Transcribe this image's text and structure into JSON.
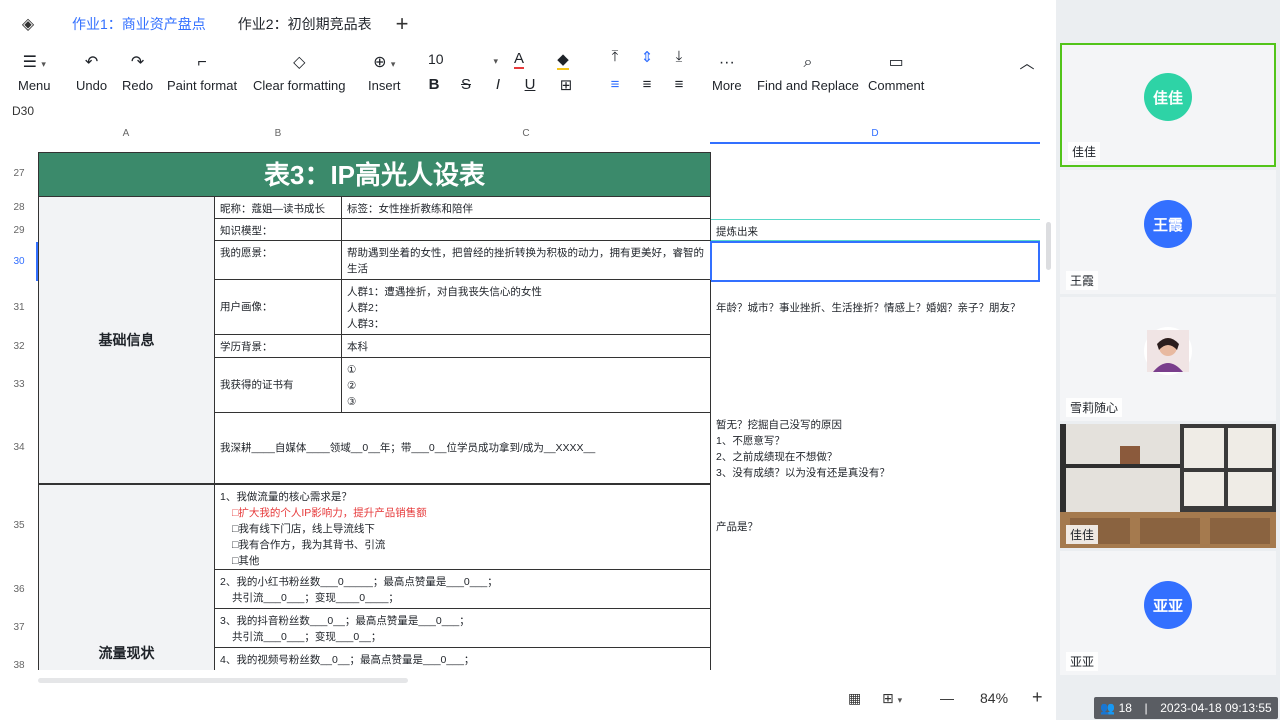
{
  "tabs": [
    {
      "label": "作业1：商业资产盘点",
      "active": true
    },
    {
      "label": "作业2：初创期竞品表",
      "active": false
    }
  ],
  "toolbar": {
    "menu": "Menu",
    "undo": "Undo",
    "redo": "Redo",
    "paint_format": "Paint format",
    "clear_formatting": "Clear formatting",
    "insert": "Insert",
    "font_size": "10",
    "more": "More",
    "find_replace": "Find and Replace",
    "comment": "Comment"
  },
  "cell_ref": "D30",
  "columns": [
    "A",
    "B",
    "C",
    "D"
  ],
  "rows": [
    "27",
    "28",
    "29",
    "30",
    "31",
    "32",
    "33",
    "34",
    "35",
    "36",
    "37",
    "38"
  ],
  "sheet": {
    "title": "表3：IP高光人设表",
    "section_basic": "基础信息",
    "section_traffic": "流量现状",
    "nickname": "昵称：蔻姐—读书成长",
    "tag": "标签：女性挫折教练和陪伴",
    "knowledge_model": "知识模型：",
    "refine_note": "提炼出来",
    "wish_label": "我的愿景：",
    "wish_value": "帮助遇到坐着的女性，把曾经的挫折转换为积极的动力，拥有更美好，睿智的生活",
    "persona_label": "用户画像：",
    "persona_1": "人群1：遭遇挫折，对自我丧失信心的女性",
    "persona_2": "人群2：",
    "persona_3": "人群3：",
    "persona_note": "年龄？城市？事业挫折、生活挫折？情感上？婚姻？亲子？朋友？",
    "edu_label": "学历背景：",
    "edu_value": "本科",
    "cert_label": "我获得的证书有",
    "cert_1": "①",
    "cert_2": "②",
    "cert_3": "③",
    "deep_text": "我深耕____自媒体____领域__0__年；带___0__位学员成功拿到/成为__XXXX__",
    "deep_note_1": "暂无？挖掘自己没写的原因",
    "deep_note_2": "1、不愿意写？",
    "deep_note_3": "2、之前成绩现在不想做？",
    "deep_note_4": "3、没有成绩？以为没有还是真没有？",
    "q1": "1、我做流量的核心需求是？",
    "q1_opt1": "□扩大我的个人IP影响力，提升产品销售额",
    "q1_opt2": "□我有线下门店，线上导流线下",
    "q1_opt3": "□我有合作方，我为其背书、引流",
    "q1_opt4": "□其他",
    "product_note": "产品是？",
    "q2a": "2、我的小红书粉丝数___0_____；最高点赞量是___0___；",
    "q2b": "共引流___0___；变现____0____；",
    "q3a": "3、我的抖音粉丝数___0__；最高点赞量是___0___；",
    "q3b": "共引流___0___；变现___0__；",
    "q4a": "4、我的视频号粉丝数__0__；最高点赞量是___0___；"
  },
  "zoom": "84%",
  "participants": [
    {
      "name": "佳佳",
      "initials": "佳佳",
      "color": "#2ed3a6",
      "speaking": true
    },
    {
      "name": "王霞",
      "initials": "王霞",
      "color": "#3370ff",
      "speaking": false
    },
    {
      "name": "雪莉随心",
      "initials": "",
      "color": "#c9505a",
      "speaking": false
    },
    {
      "name": "佳佳",
      "initials": "",
      "color": "#8a6a4d",
      "speaking": false
    },
    {
      "name": "亚亚",
      "initials": "亚亚",
      "color": "#3370ff",
      "speaking": false
    }
  ],
  "status": {
    "count": "18",
    "datetime": "2023-04-18 09:13:55"
  }
}
